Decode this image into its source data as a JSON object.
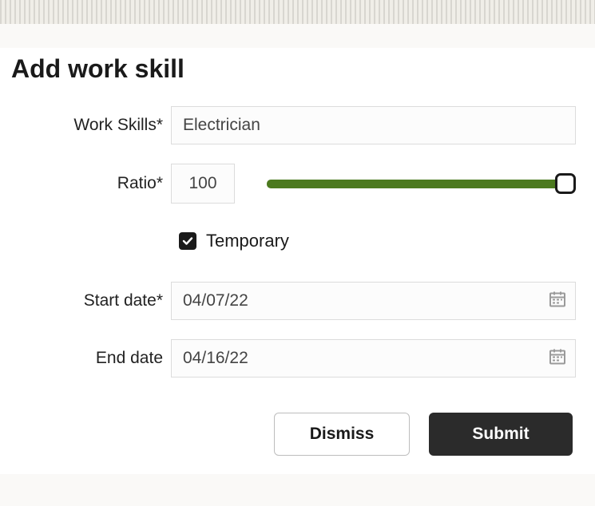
{
  "title": "Add work skill",
  "labels": {
    "work_skills": "Work Skills*",
    "ratio": "Ratio*",
    "temporary": "Temporary",
    "start_date": "Start date*",
    "end_date": "End date"
  },
  "values": {
    "work_skills": "Electrician",
    "ratio": "100",
    "temporary_checked": true,
    "start_date": "04/07/22",
    "end_date": "04/16/22"
  },
  "slider": {
    "fill_color": "#4c7a1f",
    "value": 100
  },
  "buttons": {
    "dismiss": "Dismiss",
    "submit": "Submit"
  }
}
